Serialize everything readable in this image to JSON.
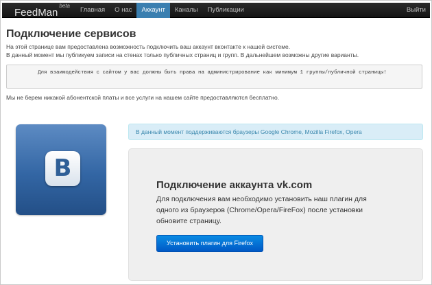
{
  "navbar": {
    "brand": "FeedMan",
    "brand_sup": "beta",
    "items": [
      {
        "label": "Главная"
      },
      {
        "label": "О нас"
      },
      {
        "label": "Аккаунт"
      },
      {
        "label": "Каналы"
      },
      {
        "label": "Публикации"
      }
    ],
    "active_item": "Аккаунт",
    "logout_label": "Выйти",
    "active_color": "#3a7fb0"
  },
  "page": {
    "title": "Подключение сервисов",
    "intro_lines": [
      "На этой странице вам предоставлена возможность подключить ваш аккаунт вконтакте к нашей системе.",
      "В данный момент мы публикуем записи на стенах только публичных страниц и групп. В дальнейшем возможны другие варианты."
    ],
    "notice": "Для взаимодействия с сайтом у вас должны быть права на администрирование как минимум 1 группы/публичной страницы!",
    "free_text": "Мы не берем никакой абонентской платы и все услуги на нашем сайте предоставляются бесплатно."
  },
  "vk_logo": {
    "icon": "vk-logo-icon",
    "letter": "В",
    "color": "#3366a4"
  },
  "alert": {
    "text": "В данный момент поддерживаются браузеры Google Chrome, Mozilla Firefox, Opera"
  },
  "connect_panel": {
    "title": "Подключение аккаунта vk.com",
    "text_lines": [
      "Для подключения вам необходимо установить наш плагин для",
      "одного из браузеров (Chrome/Opera/FireFox) после установки",
      "обновите страницу."
    ],
    "button_label": "Установить плагин для Firefox",
    "button_color": "#0a73d6"
  }
}
